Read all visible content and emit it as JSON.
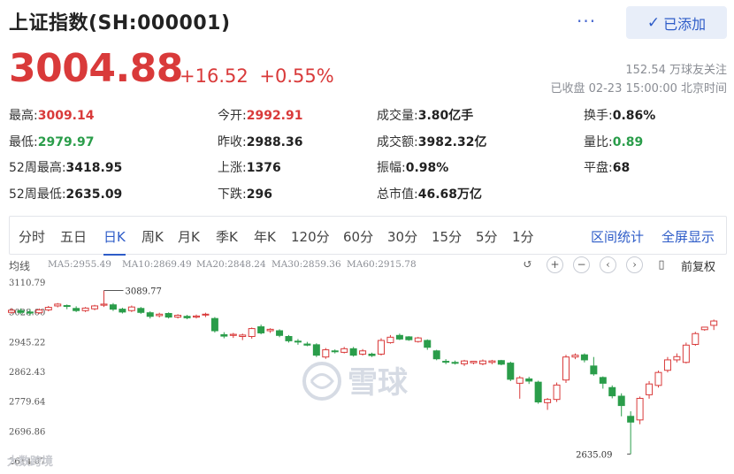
{
  "header": {
    "title": "上证指数(SH:000001)",
    "more": "···",
    "added_label": "已添加"
  },
  "quote": {
    "price": "3004.88",
    "change": "+16.52",
    "change_pct": "+0.55%",
    "followers": "152.54 万球友关注",
    "status": "已收盘 02-23 15:00:00 北京时间"
  },
  "stats": [
    [
      {
        "label": "最高:",
        "value": "3009.14",
        "color": "red"
      },
      {
        "label": "今开:",
        "value": "2992.91",
        "color": "red"
      },
      {
        "label": "成交量:",
        "value": "3.80亿手",
        "color": ""
      },
      {
        "label": "换手:",
        "value": "0.86%",
        "color": ""
      }
    ],
    [
      {
        "label": "最低:",
        "value": "2979.97",
        "color": "green"
      },
      {
        "label": "昨收:",
        "value": "2988.36",
        "color": ""
      },
      {
        "label": "成交额:",
        "value": "3982.32亿",
        "color": ""
      },
      {
        "label": "量比:",
        "value": "0.89",
        "color": "green"
      }
    ],
    [
      {
        "label": "52周最高:",
        "value": "3418.95",
        "color": ""
      },
      {
        "label": "上涨:",
        "value": "1376",
        "color": ""
      },
      {
        "label": "振幅:",
        "value": "0.98%",
        "color": ""
      },
      {
        "label": "平盘:",
        "value": "68",
        "color": ""
      }
    ],
    [
      {
        "label": "52周最低:",
        "value": "2635.09",
        "color": ""
      },
      {
        "label": "下跌:",
        "value": "296",
        "color": ""
      },
      {
        "label": "总市值:",
        "value": "46.68万亿",
        "color": ""
      },
      {
        "label": "",
        "value": "",
        "color": ""
      }
    ]
  ],
  "tabs": [
    "分时",
    "五日",
    "日K",
    "周K",
    "月K",
    "季K",
    "年K",
    "120分",
    "60分",
    "30分",
    "15分",
    "5分",
    "1分"
  ],
  "active_tab": "日K",
  "tab_actions": [
    "区间统计",
    "全屏显示"
  ],
  "ma_bar": {
    "label": "均线",
    "items": [
      "MA5:2955.49",
      "MA10:2869.49",
      "MA20:2848.24",
      "MA30:2859.36",
      "MA60:2915.78"
    ],
    "controls": [
      "↺",
      "+",
      "−",
      "‹",
      "›",
      "▯"
    ],
    "fq_label": "前复权"
  },
  "chart_data": {
    "type": "candlestick",
    "y_ticks": [
      "3110.79",
      "3028.00",
      "2945.22",
      "2862.43",
      "2779.64",
      "2696.86",
      "2614.07"
    ],
    "y_tick_values": [
      3110.79,
      3028.0,
      2945.22,
      2862.43,
      2779.64,
      2696.86,
      2614.07
    ],
    "ylim": [
      2614.07,
      3110.79
    ],
    "high_annotation": "3089.77",
    "low_annotation": "2635.09",
    "high_value": 3089.77,
    "low_value": 2635.09,
    "up_color": "#d93a3a",
    "down_color": "#2a9d4a",
    "candles": [
      {
        "o": 3029,
        "h": 3041,
        "c": 3035,
        "l": 3025
      },
      {
        "o": 3034,
        "h": 3040,
        "c": 3029,
        "l": 3024
      },
      {
        "o": 3030,
        "h": 3038,
        "c": 3027,
        "l": 3020
      },
      {
        "o": 3028,
        "h": 3040,
        "c": 3036,
        "l": 3025
      },
      {
        "o": 3036,
        "h": 3047,
        "c": 3043,
        "l": 3032
      },
      {
        "o": 3047,
        "h": 3055,
        "c": 3052,
        "l": 3043
      },
      {
        "o": 3048,
        "h": 3051,
        "c": 3046,
        "l": 3038
      },
      {
        "o": 3040,
        "h": 3046,
        "c": 3034,
        "l": 3030
      },
      {
        "o": 3034,
        "h": 3044,
        "c": 3041,
        "l": 3030
      },
      {
        "o": 3039,
        "h": 3050,
        "c": 3047,
        "l": 3035
      },
      {
        "o": 3049,
        "h": 3090,
        "c": 3052,
        "l": 3044
      },
      {
        "o": 3050,
        "h": 3055,
        "c": 3038,
        "l": 3033
      },
      {
        "o": 3038,
        "h": 3042,
        "c": 3030,
        "l": 3026
      },
      {
        "o": 3034,
        "h": 3048,
        "c": 3044,
        "l": 3030
      },
      {
        "o": 3040,
        "h": 3044,
        "c": 3029,
        "l": 3025
      },
      {
        "o": 3028,
        "h": 3032,
        "c": 3018,
        "l": 3012
      },
      {
        "o": 3020,
        "h": 3028,
        "c": 3024,
        "l": 3015
      },
      {
        "o": 3026,
        "h": 3029,
        "c": 3016,
        "l": 3012
      },
      {
        "o": 3016,
        "h": 3024,
        "c": 3021,
        "l": 3012
      },
      {
        "o": 3018,
        "h": 3022,
        "c": 3014,
        "l": 3010
      },
      {
        "o": 3016,
        "h": 3023,
        "c": 3019,
        "l": 3012
      },
      {
        "o": 3022,
        "h": 3028,
        "c": 3024,
        "l": 3016
      },
      {
        "o": 3012,
        "h": 3016,
        "c": 2978,
        "l": 2973
      },
      {
        "o": 2967,
        "h": 2974,
        "c": 2963,
        "l": 2957
      },
      {
        "o": 2965,
        "h": 2972,
        "c": 2968,
        "l": 2958
      },
      {
        "o": 2962,
        "h": 2970,
        "c": 2966,
        "l": 2952
      },
      {
        "o": 2962,
        "h": 2987,
        "c": 2984,
        "l": 2956
      },
      {
        "o": 2989,
        "h": 2995,
        "c": 2972,
        "l": 2968
      },
      {
        "o": 2978,
        "h": 2985,
        "c": 2982,
        "l": 2972
      },
      {
        "o": 2978,
        "h": 2982,
        "c": 2965,
        "l": 2960
      },
      {
        "o": 2962,
        "h": 2966,
        "c": 2950,
        "l": 2945
      },
      {
        "o": 2949,
        "h": 2955,
        "c": 2947,
        "l": 2939
      },
      {
        "o": 2941,
        "h": 2947,
        "c": 2938,
        "l": 2935
      },
      {
        "o": 2939,
        "h": 2943,
        "c": 2910,
        "l": 2905
      },
      {
        "o": 2905,
        "h": 2930,
        "c": 2925,
        "l": 2900
      },
      {
        "o": 2922,
        "h": 2926,
        "c": 2920,
        "l": 2915
      },
      {
        "o": 2918,
        "h": 2933,
        "c": 2928,
        "l": 2915
      },
      {
        "o": 2928,
        "h": 2933,
        "c": 2910,
        "l": 2906
      },
      {
        "o": 2913,
        "h": 2927,
        "c": 2922,
        "l": 2909
      },
      {
        "o": 2913,
        "h": 2917,
        "c": 2909,
        "l": 2905
      },
      {
        "o": 2913,
        "h": 2957,
        "c": 2951,
        "l": 2909
      },
      {
        "o": 2945,
        "h": 2966,
        "c": 2960,
        "l": 2942
      },
      {
        "o": 2965,
        "h": 2970,
        "c": 2955,
        "l": 2952
      },
      {
        "o": 2961,
        "h": 2963,
        "c": 2953,
        "l": 2950
      },
      {
        "o": 2948,
        "h": 2961,
        "c": 2958,
        "l": 2945
      },
      {
        "o": 2951,
        "h": 2954,
        "c": 2932,
        "l": 2925
      },
      {
        "o": 2922,
        "h": 2925,
        "c": 2900,
        "l": 2896
      },
      {
        "o": 2893,
        "h": 2899,
        "c": 2891,
        "l": 2885
      },
      {
        "o": 2890,
        "h": 2895,
        "c": 2889,
        "l": 2884
      },
      {
        "o": 2886,
        "h": 2897,
        "c": 2894,
        "l": 2880
      },
      {
        "o": 2889,
        "h": 2894,
        "c": 2893,
        "l": 2885
      },
      {
        "o": 2886,
        "h": 2898,
        "c": 2894,
        "l": 2882
      },
      {
        "o": 2890,
        "h": 2897,
        "c": 2894,
        "l": 2885
      },
      {
        "o": 2895,
        "h": 2897,
        "c": 2885,
        "l": 2882
      },
      {
        "o": 2888,
        "h": 2892,
        "c": 2843,
        "l": 2838
      },
      {
        "o": 2832,
        "h": 2852,
        "c": 2847,
        "l": 2789
      },
      {
        "o": 2844,
        "h": 2850,
        "c": 2838,
        "l": 2830
      },
      {
        "o": 2835,
        "h": 2839,
        "c": 2780,
        "l": 2775
      },
      {
        "o": 2778,
        "h": 2791,
        "c": 2787,
        "l": 2758
      },
      {
        "o": 2787,
        "h": 2834,
        "c": 2827,
        "l": 2780
      },
      {
        "o": 2841,
        "h": 2911,
        "c": 2905,
        "l": 2833
      },
      {
        "o": 2905,
        "h": 2915,
        "c": 2910,
        "l": 2899
      },
      {
        "o": 2911,
        "h": 2915,
        "c": 2897,
        "l": 2890
      },
      {
        "o": 2880,
        "h": 2905,
        "c": 2858,
        "l": 2853
      },
      {
        "o": 2848,
        "h": 2851,
        "c": 2832,
        "l": 2817
      },
      {
        "o": 2820,
        "h": 2826,
        "c": 2797,
        "l": 2790
      },
      {
        "o": 2796,
        "h": 2804,
        "c": 2770,
        "l": 2740
      },
      {
        "o": 2740,
        "h": 2754,
        "c": 2724,
        "l": 2635
      },
      {
        "o": 2730,
        "h": 2795,
        "c": 2790,
        "l": 2718
      },
      {
        "o": 2800,
        "h": 2838,
        "c": 2830,
        "l": 2789
      },
      {
        "o": 2826,
        "h": 2867,
        "c": 2862,
        "l": 2820
      },
      {
        "o": 2868,
        "h": 2905,
        "c": 2897,
        "l": 2862
      },
      {
        "o": 2897,
        "h": 2915,
        "c": 2906,
        "l": 2890
      },
      {
        "o": 2890,
        "h": 2945,
        "c": 2938,
        "l": 2887
      },
      {
        "o": 2940,
        "h": 2975,
        "c": 2970,
        "l": 2936
      },
      {
        "o": 2981,
        "h": 2989,
        "c": 2988,
        "l": 2978
      },
      {
        "o": 2993,
        "h": 3009,
        "c": 3005,
        "l": 2980
      }
    ]
  }
}
